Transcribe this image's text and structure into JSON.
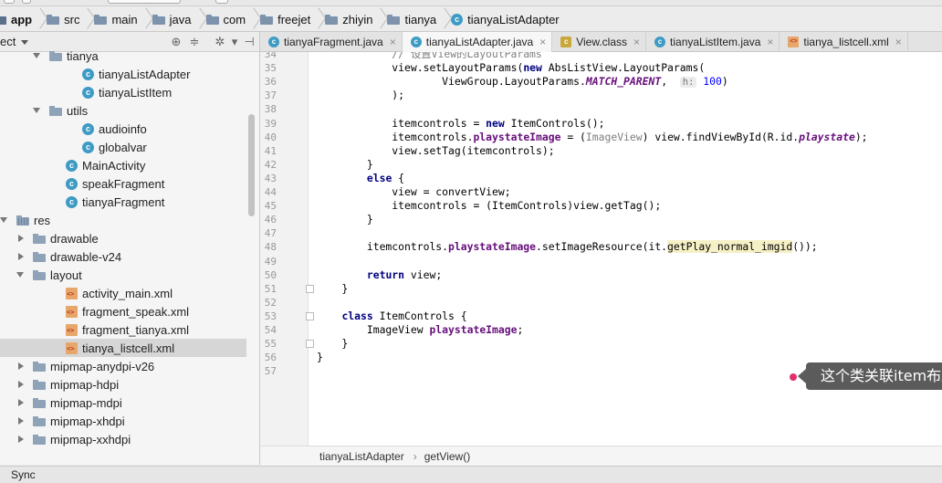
{
  "breadcrumb": [
    {
      "label": "app",
      "icon": "module-folder-icon",
      "bold": true
    },
    {
      "label": "src",
      "icon": "folder-icon"
    },
    {
      "label": "main",
      "icon": "folder-icon"
    },
    {
      "label": "java",
      "icon": "folder-icon"
    },
    {
      "label": "com",
      "icon": "package-icon"
    },
    {
      "label": "freejet",
      "icon": "package-icon"
    },
    {
      "label": "zhiyin",
      "icon": "package-icon"
    },
    {
      "label": "tianya",
      "icon": "package-icon"
    },
    {
      "label": "tianyaListAdapter",
      "icon": "class-icon"
    }
  ],
  "project_panel": {
    "title": "ect",
    "tree": [
      {
        "label": "tianya",
        "indent": 3,
        "arrow": "down",
        "icon": "folder"
      },
      {
        "label": "tianyaListAdapter",
        "indent": 5,
        "arrow": "none",
        "icon": "class"
      },
      {
        "label": "tianyaListItem",
        "indent": 5,
        "arrow": "none",
        "icon": "class"
      },
      {
        "label": "utils",
        "indent": 3,
        "arrow": "down",
        "icon": "folder"
      },
      {
        "label": "audioinfo",
        "indent": 5,
        "arrow": "none",
        "icon": "class"
      },
      {
        "label": "globalvar",
        "indent": 5,
        "arrow": "none",
        "icon": "class"
      },
      {
        "label": "MainActivity",
        "indent": 4,
        "arrow": "none",
        "icon": "class"
      },
      {
        "label": "speakFragment",
        "indent": 4,
        "arrow": "none",
        "icon": "class"
      },
      {
        "label": "tianyaFragment",
        "indent": 4,
        "arrow": "none",
        "icon": "class"
      },
      {
        "label": "res",
        "indent": 1,
        "arrow": "down",
        "icon": "res"
      },
      {
        "label": "drawable",
        "indent": 2,
        "arrow": "right",
        "icon": "folder"
      },
      {
        "label": "drawable-v24",
        "indent": 2,
        "arrow": "right",
        "icon": "folder"
      },
      {
        "label": "layout",
        "indent": 2,
        "arrow": "down",
        "icon": "folder"
      },
      {
        "label": "activity_main.xml",
        "indent": 4,
        "arrow": "none",
        "icon": "xml"
      },
      {
        "label": "fragment_speak.xml",
        "indent": 4,
        "arrow": "none",
        "icon": "xml"
      },
      {
        "label": "fragment_tianya.xml",
        "indent": 4,
        "arrow": "none",
        "icon": "xml"
      },
      {
        "label": "tianya_listcell.xml",
        "indent": 4,
        "arrow": "none",
        "icon": "xml",
        "selected": true
      },
      {
        "label": "mipmap-anydpi-v26",
        "indent": 2,
        "arrow": "right",
        "icon": "folder"
      },
      {
        "label": "mipmap-hdpi",
        "indent": 2,
        "arrow": "right",
        "icon": "folder"
      },
      {
        "label": "mipmap-mdpi",
        "indent": 2,
        "arrow": "right",
        "icon": "folder"
      },
      {
        "label": "mipmap-xhdpi",
        "indent": 2,
        "arrow": "right",
        "icon": "folder"
      },
      {
        "label": "mipmap-xxhdpi",
        "indent": 2,
        "arrow": "right",
        "icon": "folder"
      }
    ]
  },
  "tabs": [
    {
      "label": "tianyaFragment.java",
      "icon": "class",
      "active": false
    },
    {
      "label": "tianyaListAdapter.java",
      "icon": "class",
      "active": true
    },
    {
      "label": "View.class",
      "icon": "classfile",
      "active": false
    },
    {
      "label": "tianyaListItem.java",
      "icon": "class",
      "active": false
    },
    {
      "label": "tianya_listcell.xml",
      "icon": "xml",
      "active": false
    }
  ],
  "code_lines": [
    {
      "n": "34",
      "html": "            <span class=\"grey\">// 设置View的LayoutParams</span>"
    },
    {
      "n": "35",
      "html": "            view.setLayoutParams(<span class=\"kw\">new</span> AbsListView.LayoutParams("
    },
    {
      "n": "36",
      "html": "                    ViewGroup.LayoutParams.<span class=\"const\">MATCH_PARENT</span>,  <span class=\"hint\">h:</span> <span class=\"num\">100</span>)"
    },
    {
      "n": "37",
      "html": "            );"
    },
    {
      "n": "38",
      "html": ""
    },
    {
      "n": "39",
      "html": "            itemcontrols = <span class=\"kw\">new</span> ItemControls();"
    },
    {
      "n": "40",
      "html": "            itemcontrols.<span class=\"fld\">playstateImage</span> = (<span class=\"grey\">ImageView</span>) view.findViewById(R.id.<span class=\"const\">playstate</span>);"
    },
    {
      "n": "41",
      "html": "            view.setTag(itemcontrols);"
    },
    {
      "n": "42",
      "html": "        }"
    },
    {
      "n": "43",
      "html": "        <span class=\"kw\">else</span> {"
    },
    {
      "n": "44",
      "html": "            view = convertView;"
    },
    {
      "n": "45",
      "html": "            itemcontrols = (ItemControls)view.getTag();"
    },
    {
      "n": "46",
      "html": "        }"
    },
    {
      "n": "47",
      "html": ""
    },
    {
      "n": "48",
      "html": "        itemcontrols.<span class=\"fld\">playstateImage</span>.setImageResource(it.<span class=\"hl\">getPlay_normal_imgid</span>());"
    },
    {
      "n": "49",
      "html": ""
    },
    {
      "n": "50",
      "html": "        <span class=\"kw\">return</span> view;"
    },
    {
      "n": "51",
      "html": "    }"
    },
    {
      "n": "52",
      "html": ""
    },
    {
      "n": "53",
      "html": "    <span class=\"kw\">class</span> ItemControls {"
    },
    {
      "n": "54",
      "html": "        ImageView <span class=\"fld\">playstateImage</span>;"
    },
    {
      "n": "55",
      "html": "    }"
    },
    {
      "n": "56",
      "html": "}"
    },
    {
      "n": "57",
      "html": ""
    }
  ],
  "callout": {
    "text": "这个类关联item布局中的所有控件"
  },
  "editor_footer": {
    "class_name": "tianyaListAdapter",
    "method_name": "getView()"
  },
  "status_bar": {
    "text": "Sync"
  },
  "colors": {
    "class_icon": "#3e9bc4",
    "keyword": "#000080",
    "field": "#660e7a",
    "number": "#0000ff",
    "callout_bg": "#5b5b5b",
    "callout_dot": "#e0306a"
  }
}
